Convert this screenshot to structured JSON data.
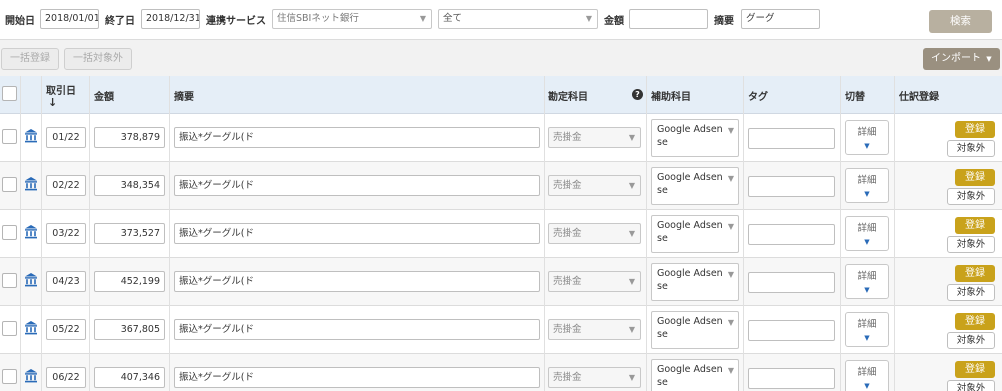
{
  "filter": {
    "start_label": "開始日",
    "start_date": "2018/01/01",
    "end_label": "終了日",
    "end_date": "2018/12/31",
    "service_label": "連携サービス",
    "service_value": "住信SBIネット銀行",
    "category_value": "全て",
    "amount_label": "金額",
    "amount_value": "",
    "description_label": "摘要",
    "description_value": "グーグ",
    "search_label": "検索"
  },
  "actions": {
    "bulk_register": "一括登録",
    "bulk_exclude": "一括対象外",
    "import": "インポート"
  },
  "table": {
    "headers": {
      "date": "取引日",
      "amount": "金額",
      "description": "摘要",
      "account": "勘定科目",
      "sub_account": "補助科目",
      "tag": "タグ",
      "switch": "切替",
      "register": "仕訳登録"
    },
    "sort_arrow": "↓",
    "help_icon": "?",
    "rows": [
      {
        "date": "01/22",
        "amount": "378,879",
        "description": "振込*グーグル(ド",
        "account": "売掛金",
        "sub_account": "Google Adsense",
        "detail": "詳細",
        "register": "登録",
        "exclude": "対象外"
      },
      {
        "date": "02/22",
        "amount": "348,354",
        "description": "振込*グーグル(ド",
        "account": "売掛金",
        "sub_account": "Google Adsense",
        "detail": "詳細",
        "register": "登録",
        "exclude": "対象外"
      },
      {
        "date": "03/22",
        "amount": "373,527",
        "description": "振込*グーグル(ド",
        "account": "売掛金",
        "sub_account": "Google Adsense",
        "detail": "詳細",
        "register": "登録",
        "exclude": "対象外"
      },
      {
        "date": "04/23",
        "amount": "452,199",
        "description": "振込*グーグル(ド",
        "account": "売掛金",
        "sub_account": "Google Adsense",
        "detail": "詳細",
        "register": "登録",
        "exclude": "対象外"
      },
      {
        "date": "05/22",
        "amount": "367,805",
        "description": "振込*グーグル(ド",
        "account": "売掛金",
        "sub_account": "Google Adsense",
        "detail": "詳細",
        "register": "登録",
        "exclude": "対象外"
      },
      {
        "date": "06/22",
        "amount": "407,346",
        "description": "振込*グーグル(ド",
        "account": "売掛金",
        "sub_account": "Google Adsense",
        "detail": "詳細",
        "register": "登録",
        "exclude": "対象外"
      }
    ]
  },
  "colors": {
    "register_button": "#c9a21b",
    "header_background": "#e5eef7",
    "search_button": "#b8b0a0",
    "import_button": "#9a9080",
    "bank_icon": "#2a6bb8"
  },
  "icons": {
    "row_icon": "bank-icon",
    "select_caret": "caret-down-icon",
    "detail_chevron": "chevron-down-icon"
  }
}
